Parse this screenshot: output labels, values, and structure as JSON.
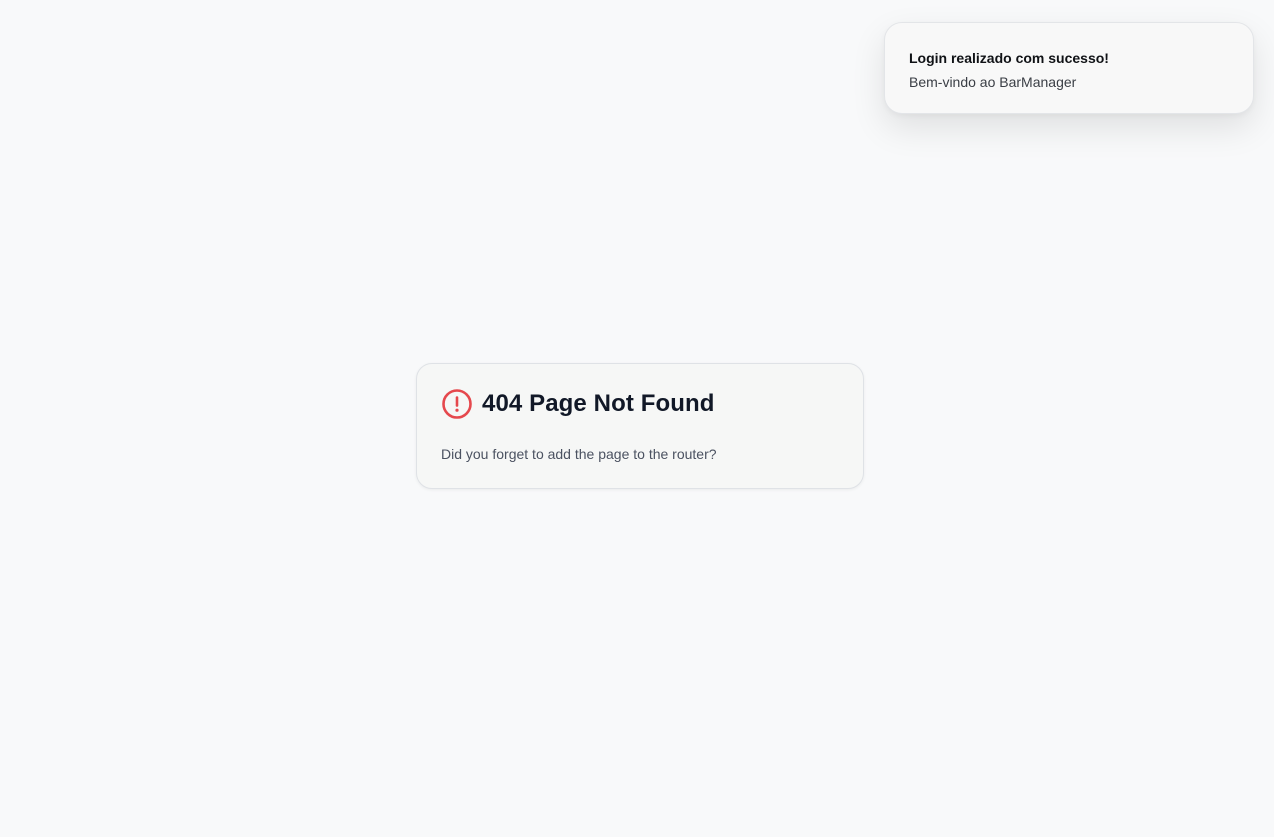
{
  "toast": {
    "title": "Login realizado com sucesso!",
    "description": "Bem-vindo ao BarManager"
  },
  "not_found_card": {
    "icon": "alert-circle-icon",
    "title": "404 Page Not Found",
    "message": "Did you forget to add the page to the router?"
  },
  "colors": {
    "background": "#f8f9fa",
    "alert_icon": "#e5484d",
    "title_text": "#111827",
    "body_text": "#4b5261"
  }
}
